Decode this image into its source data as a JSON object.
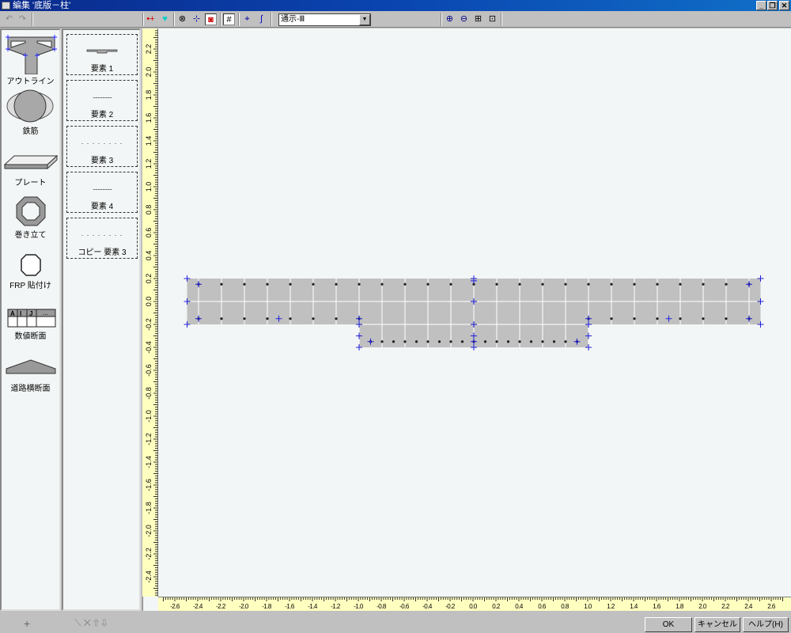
{
  "window": {
    "title": "編集 '底版－柱'",
    "minimize": "_",
    "restore": "❐",
    "close": "✕"
  },
  "toolbar": {
    "undo": "↶",
    "redo": "↷",
    "view_select": "通示-Ⅲ"
  },
  "palette": [
    {
      "label": "アウトライン",
      "icon": "outline-icon"
    },
    {
      "label": "鉄筋",
      "icon": "rebar-icon"
    },
    {
      "label": "プレート",
      "icon": "plate-icon"
    },
    {
      "label": "巻き立て",
      "icon": "jacket-icon"
    },
    {
      "label": "FRP 貼付け",
      "icon": "frp-icon"
    },
    {
      "label": "数値断面",
      "icon": "numeric-section-icon",
      "table_headers": [
        "A",
        "I",
        "J",
        "..."
      ]
    },
    {
      "label": "道路横断面",
      "icon": "road-section-icon"
    }
  ],
  "elements": [
    {
      "label": "要素 1",
      "preview": "▭"
    },
    {
      "label": "要素 2",
      "preview": "................"
    },
    {
      "label": "要素 3",
      "preview": ". . . . . . . ."
    },
    {
      "label": "要素 4",
      "preview": "................"
    },
    {
      "label": "コピー 要素 3",
      "preview": ". . . . . . . ."
    }
  ],
  "rulers": {
    "x_ticks": [
      "-2.6",
      "-2.4",
      "-2.2",
      "-2.0",
      "-1.8",
      "-1.6",
      "-1.4",
      "-1.2",
      "-1.0",
      "-0.8",
      "-0.6",
      "-0.4",
      "-0.2",
      "0.0",
      "0.2",
      "0.4",
      "0.6",
      "0.8",
      "1.0",
      "1.2",
      "1.4",
      "1.6",
      "1.8",
      "2.0",
      "2.2",
      "2.4",
      "2.6"
    ],
    "y_ticks": [
      "2.2",
      "2.0",
      "1.8",
      "1.6",
      "1.4",
      "1.2",
      "1.0",
      "0.8",
      "0.6",
      "0.4",
      "0.2",
      "0.0",
      "-0.2",
      "-0.4",
      "-0.6",
      "-0.8",
      "-1.0",
      "-1.2",
      "-1.4",
      "-1.6",
      "-1.8",
      "-2.0",
      "-2.2",
      "-2.4"
    ]
  },
  "section": {
    "outline": [
      [
        -2.5,
        0.2
      ],
      [
        2.5,
        0.2
      ],
      [
        2.5,
        -0.2
      ],
      [
        1.0,
        -0.2
      ],
      [
        1.0,
        -0.4
      ],
      [
        -1.0,
        -0.4
      ],
      [
        -1.0,
        -0.2
      ],
      [
        -2.5,
        -0.2
      ]
    ],
    "vertices": [
      [
        -2.5,
        0.2
      ],
      [
        -2.5,
        0
      ],
      [
        -2.5,
        -0.2
      ],
      [
        2.5,
        0.2
      ],
      [
        2.5,
        0
      ],
      [
        2.5,
        -0.2
      ],
      [
        0,
        0.2
      ],
      [
        0,
        0.18
      ],
      [
        0,
        0
      ],
      [
        0,
        -0.2
      ],
      [
        0,
        -0.3
      ],
      [
        0,
        -0.35
      ],
      [
        0,
        -0.4
      ],
      [
        -1.0,
        -0.2
      ],
      [
        -1.0,
        -0.3
      ],
      [
        -1.0,
        -0.4
      ],
      [
        -1.0,
        -0.15
      ],
      [
        1.0,
        -0.2
      ],
      [
        1.0,
        -0.3
      ],
      [
        1.0,
        -0.4
      ],
      [
        1.0,
        -0.15
      ],
      [
        -2.4,
        0.15
      ],
      [
        2.4,
        0.15
      ],
      [
        -2.4,
        -0.15
      ],
      [
        2.4,
        -0.15
      ],
      [
        -1.7,
        -0.15
      ],
      [
        1.7,
        -0.15
      ],
      [
        -0.9,
        -0.35
      ],
      [
        0.9,
        -0.35
      ]
    ],
    "colors": {
      "fill": "#c0c0c0",
      "vertex": "#2020e0",
      "rebar": "#202020"
    }
  },
  "buttons": {
    "add": "+",
    "ok": "OK",
    "cancel": "キャンセル",
    "help": "ヘルプ(H)"
  }
}
